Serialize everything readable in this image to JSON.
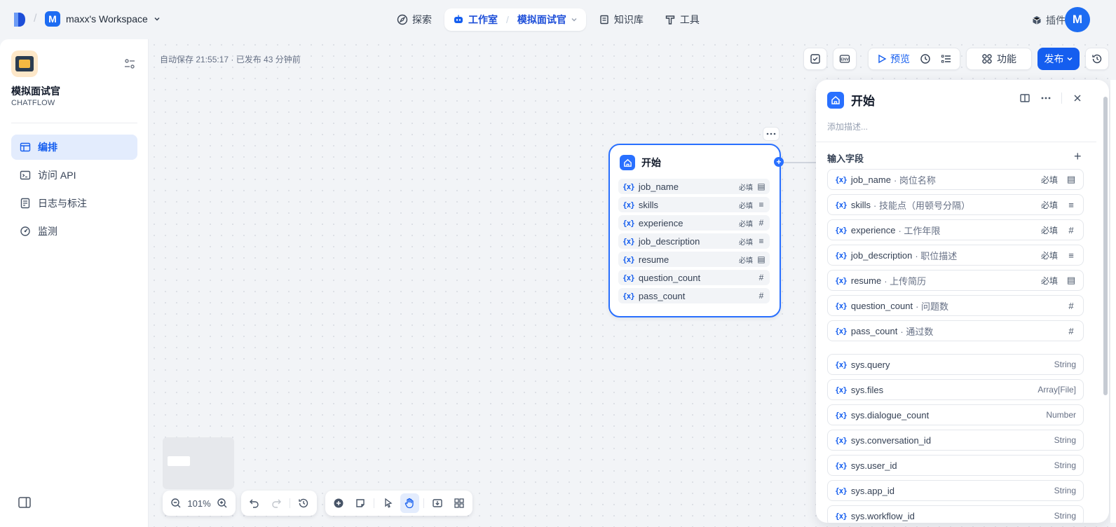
{
  "topbar": {
    "workspace_initial": "M",
    "workspace_name": "maxx's Workspace",
    "nav": {
      "explore": "探索",
      "studio": "工作室",
      "app_name": "模拟面试官",
      "knowledge": "知识库",
      "tools": "工具"
    },
    "plugins": "插件",
    "user_initial": "M"
  },
  "sidebar": {
    "app_name": "模拟面试官",
    "app_type": "CHATFLOW",
    "items": [
      {
        "label": "编排",
        "icon": "layout-icon"
      },
      {
        "label": "访问 API",
        "icon": "terminal-icon"
      },
      {
        "label": "日志与标注",
        "icon": "logs-icon"
      },
      {
        "label": "监测",
        "icon": "gauge-icon"
      }
    ]
  },
  "canvas": {
    "autosave": "自动保存 21:55:17 · 已发布 43 分钟前",
    "toolbar": {
      "preview": "预览",
      "features": "功能",
      "publish": "发布"
    },
    "zoom": "101%"
  },
  "node": {
    "title": "开始",
    "var_prefix": "{x}",
    "fields": [
      {
        "name": "job_name",
        "required": "必填",
        "type_icon": "▤"
      },
      {
        "name": "skills",
        "required": "必填",
        "type_icon": "≡"
      },
      {
        "name": "experience",
        "required": "必填",
        "type_icon": "#"
      },
      {
        "name": "job_description",
        "required": "必填",
        "type_icon": "≡"
      },
      {
        "name": "resume",
        "required": "必填",
        "type_icon": "▤"
      },
      {
        "name": "question_count",
        "required": "",
        "type_icon": "#"
      },
      {
        "name": "pass_count",
        "required": "",
        "type_icon": "#"
      }
    ]
  },
  "panel": {
    "title": "开始",
    "description_placeholder": "添加描述...",
    "section_title": "输入字段",
    "var_prefix": "{x}",
    "fields": [
      {
        "name": "job_name",
        "label": "· 岗位名称",
        "required": "必填",
        "type_icon": "▤"
      },
      {
        "name": "skills",
        "label": "· 技能点（用顿号分隔）",
        "required": "必填",
        "type_icon": "≡"
      },
      {
        "name": "experience",
        "label": "· 工作年限",
        "required": "必填",
        "type_icon": "#"
      },
      {
        "name": "job_description",
        "label": "· 职位描述",
        "required": "必填",
        "type_icon": "≡"
      },
      {
        "name": "resume",
        "label": "· 上传简历",
        "required": "必填",
        "type_icon": "▤"
      },
      {
        "name": "question_count",
        "label": "· 问题数",
        "required": "",
        "type_icon": "#"
      },
      {
        "name": "pass_count",
        "label": "· 通过数",
        "required": "",
        "type_icon": "#"
      }
    ],
    "system_vars": [
      {
        "name": "sys.query",
        "type": "String"
      },
      {
        "name": "sys.files",
        "type": "Array[File]"
      },
      {
        "name": "sys.dialogue_count",
        "type": "Number"
      },
      {
        "name": "sys.conversation_id",
        "type": "String"
      },
      {
        "name": "sys.user_id",
        "type": "String"
      },
      {
        "name": "sys.app_id",
        "type": "String"
      },
      {
        "name": "sys.workflow_id",
        "type": "String"
      }
    ]
  },
  "colors": {
    "accent": "#155eef",
    "node_border": "#2970ff"
  }
}
